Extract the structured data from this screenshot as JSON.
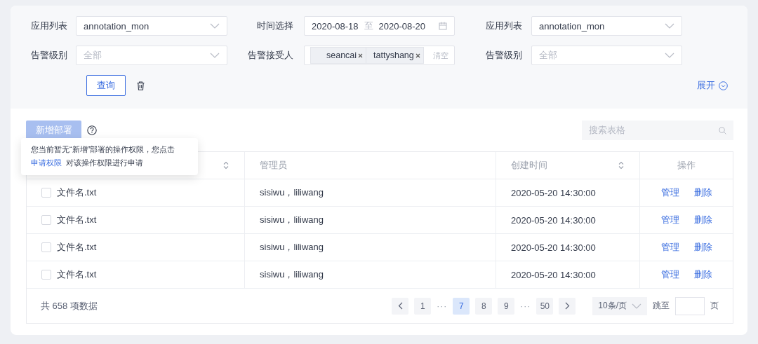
{
  "filters": [
    {
      "label": "应用列表",
      "kind": "select",
      "value": "annotation_mon"
    },
    {
      "label": "时间选择",
      "kind": "daterange",
      "start": "2020-08-18",
      "separator": "至",
      "end": "2020-08-20"
    },
    {
      "label": "应用列表",
      "kind": "select",
      "value": "annotation_mon"
    },
    {
      "label": "告警级别",
      "kind": "select",
      "placeholder": "全部"
    },
    {
      "label": "告警接受人",
      "kind": "tags",
      "tags": [
        "seancai",
        "tattyshang"
      ],
      "clear": "清空"
    },
    {
      "label": "告警级别",
      "kind": "select",
      "placeholder": "全部"
    }
  ],
  "query_button": "查询",
  "expand_link": "展开",
  "toolbar": {
    "add_button": {
      "label": "新增部署",
      "disabled": true
    },
    "search": {
      "placeholder": "搜索表格"
    }
  },
  "tooltip": {
    "text": "您当前暂无“新增”部署的操作权限，您点击",
    "link": "申请权限",
    "rest": "对该操作权限进行申请"
  },
  "table": {
    "columns": [
      {
        "sortable": true
      },
      {
        "label": "管理员",
        "sortable": false
      },
      {
        "label": "创建时间",
        "sortable": true
      },
      {
        "label": "操作",
        "sortable": false
      }
    ],
    "rows": [
      {
        "checked": false,
        "name": "文件名.txt",
        "admins": "sisiwu，liliwang",
        "created": "2020-05-20 14:30:00",
        "actions": [
          "管理",
          "删除"
        ]
      },
      {
        "checked": false,
        "name": "文件名.txt",
        "admins": "sisiwu，liliwang",
        "created": "2020-05-20 14:30:00",
        "actions": [
          "管理",
          "删除"
        ]
      },
      {
        "checked": false,
        "name": "文件名.txt",
        "admins": "sisiwu，liliwang",
        "created": "2020-05-20 14:30:00",
        "actions": [
          "管理",
          "删除"
        ]
      },
      {
        "checked": false,
        "name": "文件名.txt",
        "admins": "sisiwu，liliwang",
        "created": "2020-05-20 14:30:00",
        "actions": [
          "管理",
          "删除"
        ]
      }
    ]
  },
  "footer": {
    "total": "共 658 项数据",
    "pagination": [
      {
        "kind": "prev"
      },
      {
        "kind": "page",
        "label": "1",
        "selected": false
      },
      {
        "kind": "ellipsis",
        "label": "···"
      },
      {
        "kind": "page",
        "label": "7",
        "selected": true
      },
      {
        "kind": "page",
        "label": "8",
        "selected": false
      },
      {
        "kind": "page",
        "label": "9",
        "selected": false
      },
      {
        "kind": "ellipsis",
        "label": "···"
      },
      {
        "kind": "page",
        "label": "50",
        "selected": false
      },
      {
        "kind": "next"
      }
    ],
    "page_size": "10条/页",
    "jump_label": "跳至",
    "jump_suffix": "页"
  }
}
